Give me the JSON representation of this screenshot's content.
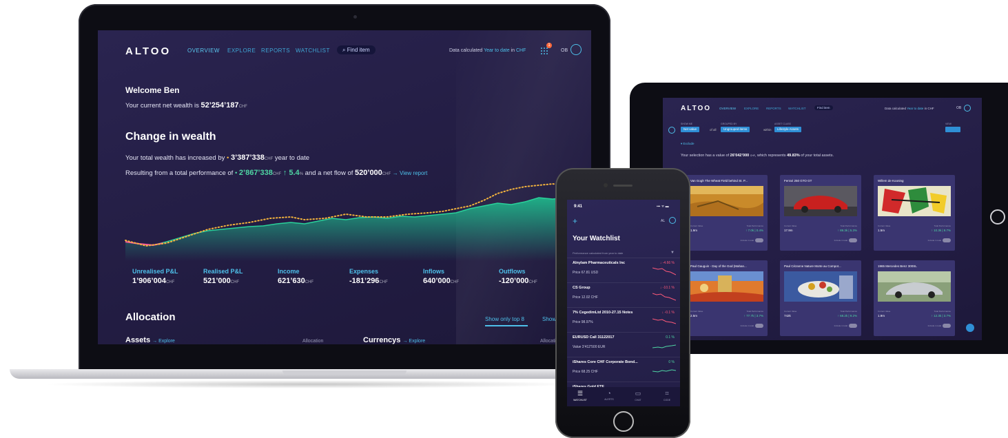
{
  "colors": {
    "accent": "#4ec0ea",
    "positive": "#4fd6a4",
    "negative": "#ff5a7a",
    "orange": "#f3b33d",
    "bg": "#241e45"
  },
  "laptop": {
    "logo": "ALTOO",
    "nav": [
      "OVERVIEW",
      "EXPLORE",
      "REPORTS",
      "WATCHLIST"
    ],
    "find": "Find item",
    "datacalc": {
      "prefix": "Data calculated",
      "period": "Year to date",
      "in": "in",
      "currency": "CHF"
    },
    "notif_count": "1",
    "user": "OB",
    "welcome": "Welcome Ben",
    "net_prefix": "Your current net wealth is",
    "net_value": "52’254’187",
    "chf": "CHF",
    "change_title": "Change in wealth",
    "inc_prefix": "Your total wealth has increased by",
    "inc_value": "3’387’338",
    "inc_suffix": "year to date",
    "perf_prefix": "Resulting from a total performance of",
    "perf_value": "2’867’338",
    "perf_pct": "↑ 5.4",
    "pct": "%",
    "perf_mid": "and a net flow of",
    "flow_value": "520’000",
    "view_report": "→ View report",
    "metrics": [
      {
        "label": "Unrealised P&L",
        "value": "1’906’004"
      },
      {
        "label": "Realised P&L",
        "value": "521’000"
      },
      {
        "label": "Income",
        "value": "621’630"
      },
      {
        "label": "Expenses",
        "value": "-181’296"
      },
      {
        "label": "Inflows",
        "value": "640’000"
      },
      {
        "label": "Outflows",
        "value": "-120’000"
      }
    ],
    "allocation": "Allocation",
    "show_top": "Show only top 8",
    "show_all": "Show",
    "assets": "Assets",
    "explore": "→ Explore",
    "alloc_col": "Allocation",
    "currencys": "Currencys",
    "alloc_col2": "Allocati"
  },
  "tablet": {
    "logo": "ALTOO",
    "nav": [
      "OVERVIEW",
      "EXPLORE",
      "REPORTS",
      "WATCHLIST"
    ],
    "find": "Find item",
    "calc": {
      "prefix": "Data calculated",
      "period": "Year to date",
      "suffix": "in CHF"
    },
    "user": "OB",
    "filters": {
      "show_lbl": "SHOW ME",
      "show_val": "Net value",
      "of_all": "of all",
      "group_lbl": "GROUPED BY",
      "group_val": "Ungrouped items",
      "within": "within",
      "class_lbl": "ASSET CLASS",
      "class_val": "Lifestyle Assets",
      "view_lbl": "VIEW"
    },
    "exclude": "Exclude",
    "summary": {
      "prefix": "Your selection has a value of",
      "value": "26’042’000",
      "chf": "CHF",
      "mid": ", which represents",
      "pct": "49.83%",
      "suffix": "of your total assets."
    },
    "cards": [
      {
        "title": "Van Gogh The Wheat Field behind St. P...",
        "cv": "1.9m",
        "perf": "↑ 7.0k | 0.4%"
      },
      {
        "title": "Ferrari 250 GTO GT",
        "cv": "17.9m",
        "perf": "↑ 89.3k | 5.3%"
      },
      {
        "title": "Willem de Kooning",
        "cv": "1.5m",
        "perf": "↑ 10.3k | 9.7%"
      },
      {
        "title": "Paul Gauguin - Day of the God (Mahan...",
        "cv": "2.5m",
        "perf": "↑ 77.7k | 3.7%"
      },
      {
        "title": "Paul Cézanne Nature Morte au Compot...",
        "cv": "742k",
        "perf": "↑ 68.2k | 9.2%"
      },
      {
        "title": "1965 Mercedes Benz 300SL",
        "cv": "1.9m",
        "perf": "↑ 12.3k | 3.7%"
      }
    ],
    "card_labels": {
      "current": "Current Value",
      "total": "Total Performance",
      "toggle": "Include in total"
    }
  },
  "phone": {
    "time": "9:41",
    "status": "▪▪▪ ᯤ ▬",
    "plus": "+",
    "user": "AL",
    "title": "Your Watchlist",
    "perf_note": "Performance calculated from year to date",
    "rows": [
      {
        "name": "Alnylam Pharmaceuticals Inc",
        "price": "Price 67.81 USD",
        "change": "↓ -4.66 %",
        "dir": "down"
      },
      {
        "name": "CS Group",
        "price": "Price 12.02 CHF",
        "change": "↓ -10.1 %",
        "dir": "down"
      },
      {
        "name": "7% CegedimLtd 2010-27.15 Notes",
        "price": "Price 98.97%",
        "change": "↓ -0.1 %",
        "dir": "down"
      },
      {
        "name": "EURUSD Call 31122017",
        "price": "Value 3’412’500 EUR",
        "change": "0.1 %",
        "dir": "up"
      },
      {
        "name": "iShares Core CHF Corporate Bond...",
        "price": "Price 68.25 CHF",
        "change": "0 %",
        "dir": "up"
      },
      {
        "name": "iShares Gold ETF",
        "price": "",
        "change": "",
        "dir": "up"
      }
    ],
    "tabs": [
      {
        "label": "WATCHLIST",
        "icon": "☰"
      },
      {
        "label": "ALERTS",
        "icon": "🔔"
      },
      {
        "label": "CHAT",
        "icon": "💬"
      },
      {
        "label": "CODE",
        "icon": "⌗"
      }
    ]
  }
}
